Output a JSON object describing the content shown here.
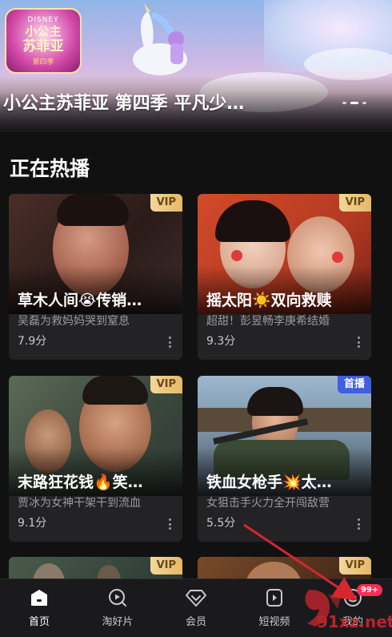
{
  "banner": {
    "title": "小公主苏菲亚 第四季 平凡少…",
    "logo": {
      "brand": "DISNEY",
      "line1": "小公主",
      "line2": "苏菲亚",
      "line3": "第四季"
    },
    "page_dots": 3,
    "active_dot": 2
  },
  "section": {
    "title": "正在热播"
  },
  "cards": [
    {
      "badge": "VIP",
      "badge_type": "vip",
      "title": "草木人间😭传销…",
      "subtitle": "吴磊为救妈妈哭到窒息",
      "score": "7.9分"
    },
    {
      "badge": "VIP",
      "badge_type": "vip",
      "title": "摇太阳☀️双向救赎",
      "subtitle": "超甜！彭昱畅李庚希结婚",
      "score": "9.3分"
    },
    {
      "badge": "VIP",
      "badge_type": "vip",
      "title": "末路狂花钱🔥笑…",
      "subtitle": "贾冰为女神干架干到流血",
      "score": "9.1分"
    },
    {
      "badge": "首播",
      "badge_type": "first",
      "title": "铁血女枪手💥太…",
      "subtitle": "女狙击手火力全开闯敌营",
      "score": "5.5分"
    }
  ],
  "partial_cards": [
    {
      "badge": "VIP"
    },
    {
      "badge": "VIP"
    }
  ],
  "bottom_nav": [
    {
      "label": "首页",
      "icon": "home-icon",
      "active": true
    },
    {
      "label": "淘好片",
      "icon": "discover-icon",
      "active": false
    },
    {
      "label": "会员",
      "icon": "vip-diamond-icon",
      "active": false
    },
    {
      "label": "短视频",
      "icon": "short-video-icon",
      "active": false
    },
    {
      "label": "我的",
      "icon": "profile-icon",
      "active": false,
      "badge": "99+"
    }
  ],
  "watermark": {
    "text": "91xz.net"
  },
  "colors": {
    "background": "#111112",
    "card": "#232326",
    "vip_badge": "#e5b867",
    "first_badge": "#3f5ee0",
    "notification": "#ff2d55",
    "arrow": "#d6262f"
  }
}
